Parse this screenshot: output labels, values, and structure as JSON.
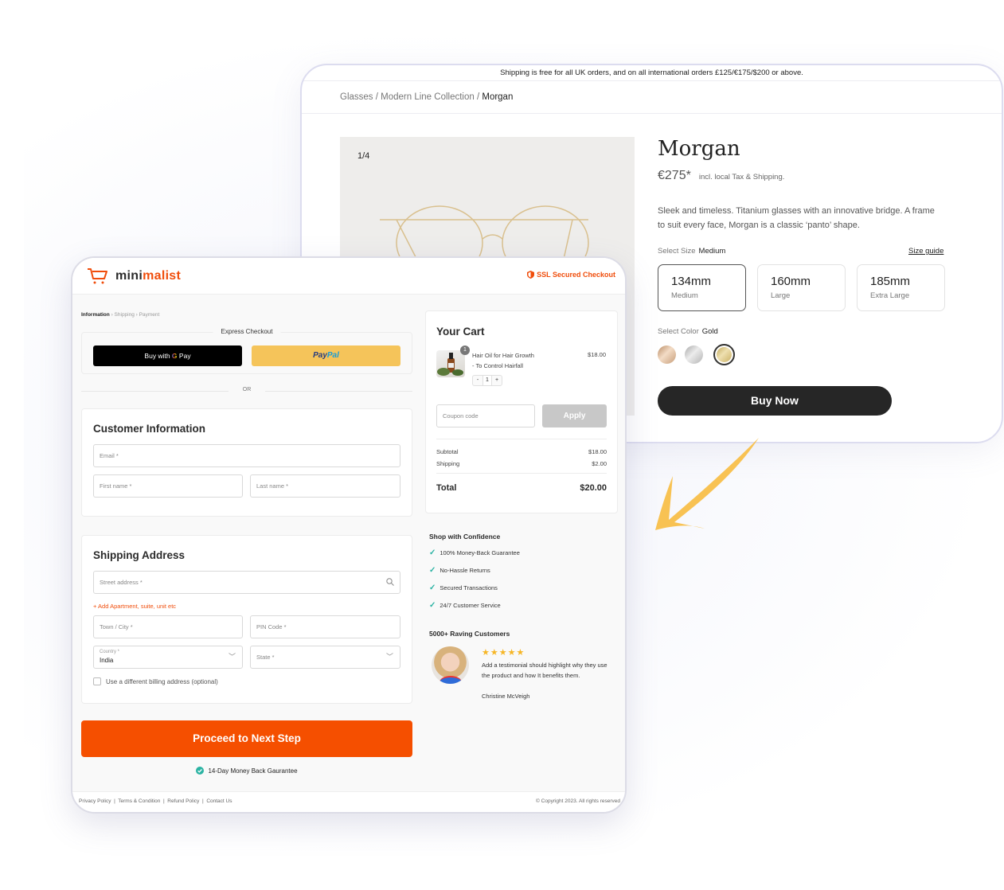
{
  "product_page": {
    "shipping_notice": "Shipping is free for all UK orders, and on all international orders £125/€175/$200 or above.",
    "breadcrumb": [
      "Glasses",
      "Modern Line Collection",
      "Morgan"
    ],
    "breadcrumb_sep": " / ",
    "gallery_counter": "1/4",
    "title": "Morgan",
    "price": "€275*",
    "price_note": "incl. local Tax & Shipping.",
    "description": "Sleek and timeless. Titanium glasses with an innovative bridge. A frame to suit every face, Morgan is a classic ‘panto’ shape.",
    "size_label": "Select Size",
    "size_selected": "Medium",
    "size_guide": "Size guide",
    "sizes": [
      {
        "mm": "134mm",
        "name": "Medium",
        "selected": true
      },
      {
        "mm": "160mm",
        "name": "Large",
        "selected": false
      },
      {
        "mm": "185mm",
        "name": "Extra Large",
        "selected": false
      }
    ],
    "color_label": "Select Color",
    "color_selected": "Gold",
    "colors": [
      {
        "name": "Rose Gold",
        "hex": "#d9b08f",
        "selected": false
      },
      {
        "name": "Silver",
        "hex": "#c9c9c9",
        "selected": false
      },
      {
        "name": "Gold",
        "hex": "#cdb468",
        "selected": true
      }
    ],
    "buy_button": "Buy Now"
  },
  "checkout": {
    "brand": {
      "prefix": "mini",
      "suffix": "malist",
      "accent": "#f04d0b"
    },
    "ssl_label": "SSL Secured Checkout",
    "steps": [
      "Information",
      "Shipping",
      "Payment"
    ],
    "express_title": "Express Checkout",
    "gpay_prefix": "Buy with",
    "gpay_g": "G",
    "gpay_suffix": "Pay",
    "paypal": {
      "part1": "Pay",
      "part2": "Pal"
    },
    "or_label": "OR",
    "customer_info": {
      "title": "Customer Information",
      "email_placeholder": "Email *",
      "first_name_placeholder": "First name *",
      "last_name_placeholder": "Last name *"
    },
    "shipping_address": {
      "title": "Shipping Address",
      "street_placeholder": "Street address *",
      "add_apartment": "+ Add Apartment, suite, unit etc",
      "city_placeholder": "Town / City *",
      "pin_placeholder": "PIN Code *",
      "country_label": "Country *",
      "country_value": "India",
      "state_placeholder": "State *",
      "billing_checkbox": "Use a different billing address (optional)",
      "billing_checked": false
    },
    "proceed_button": "Proceed to Next Step",
    "guarantee": "14-Day Money Back Gaurantee",
    "footer_links": [
      "Privacy Policy",
      "Terms & Condition",
      "Refund Policy",
      "Contact Us"
    ],
    "copyright": "© Copyright 2023. All rights reserved",
    "cart": {
      "title": "Your Cart",
      "item": {
        "name_line1": "Hair Oil for Hair Growth",
        "name_line2": "- To Control Hairfall",
        "price": "$18.00",
        "badge": "1",
        "qty": "1",
        "minus": "-",
        "plus": "+"
      },
      "coupon_placeholder": "Coupon code",
      "apply_label": "Apply",
      "subtotal_label": "Subtotal",
      "subtotal": "$18.00",
      "shipping_label": "Shipping",
      "shipping": "$2.00",
      "total_label": "Total",
      "total": "$20.00"
    },
    "confidence": {
      "title": "Shop with Confidence",
      "items": [
        "100% Money-Back Guarantee",
        "No-Hassle Returns",
        "Secured Transactions",
        "24/7 Customer Service"
      ]
    },
    "reviews": {
      "title": "5000+ Raving Customers",
      "rating": 5,
      "stars": "★★★★★",
      "testimonial": "Add a testimonial should highlight why they use the product and how It benefits them.",
      "author": "Christine McVeigh"
    }
  }
}
